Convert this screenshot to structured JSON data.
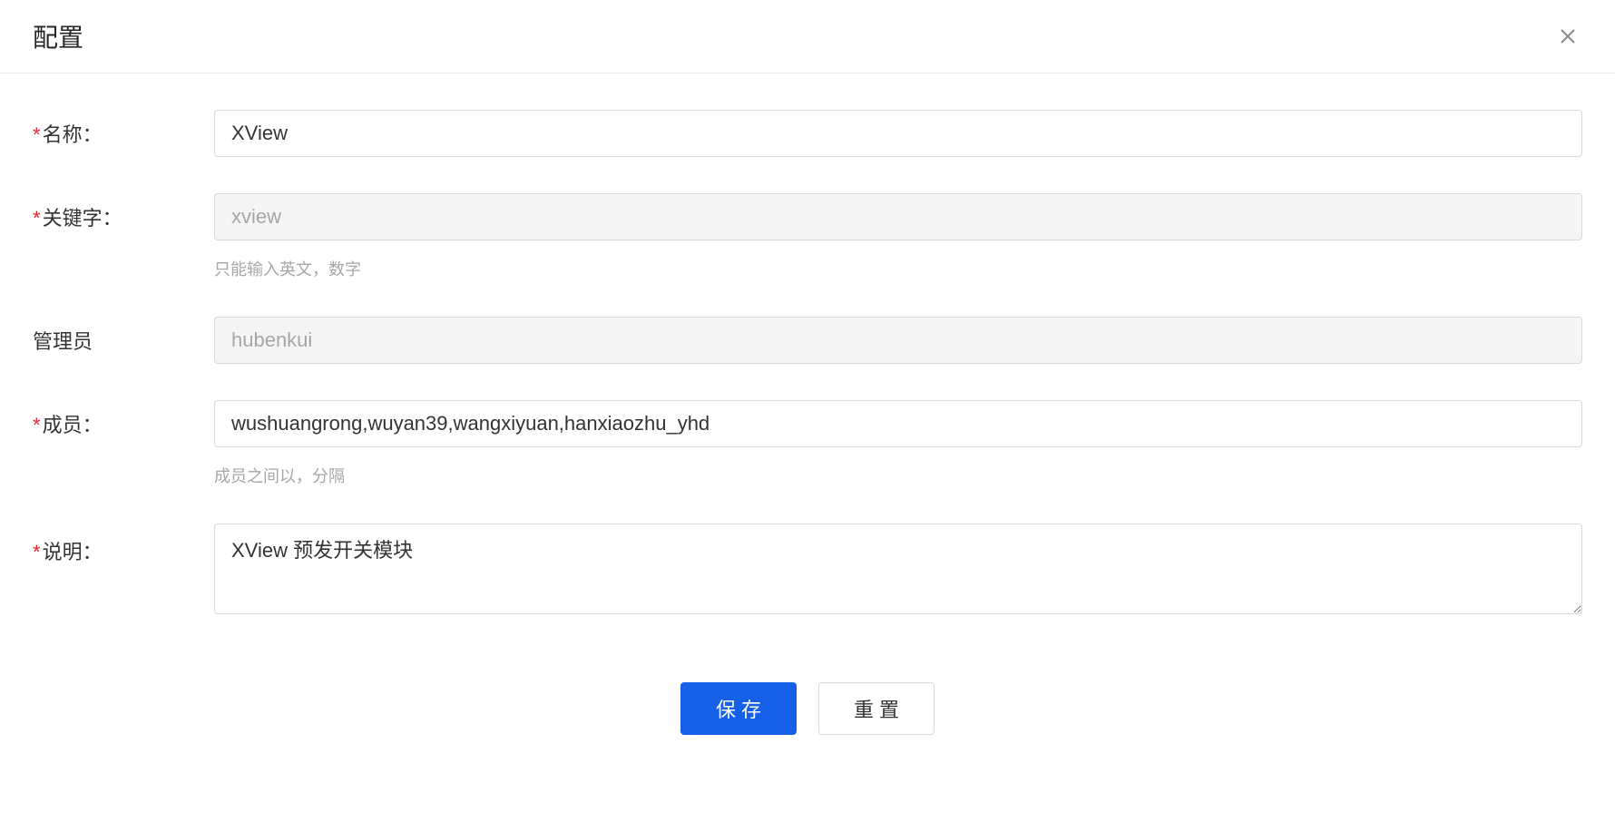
{
  "header": {
    "title": "配置"
  },
  "form": {
    "name": {
      "label": "名称：",
      "value": "XView",
      "required": true
    },
    "keyword": {
      "label": "关键字：",
      "value": "xview",
      "required": true,
      "hint": "只能输入英文，数字"
    },
    "admin": {
      "label": "管理员",
      "value": "hubenkui",
      "required": false
    },
    "members": {
      "label": "成员：",
      "value": "wushuangrong,wuyan39,wangxiyuan,hanxiaozhu_yhd",
      "required": true,
      "hint": "成员之间以，分隔"
    },
    "description": {
      "label": "说明：",
      "value": "XView 预发开关模块",
      "required": true
    }
  },
  "footer": {
    "save_label": "保存",
    "reset_label": "重置"
  }
}
